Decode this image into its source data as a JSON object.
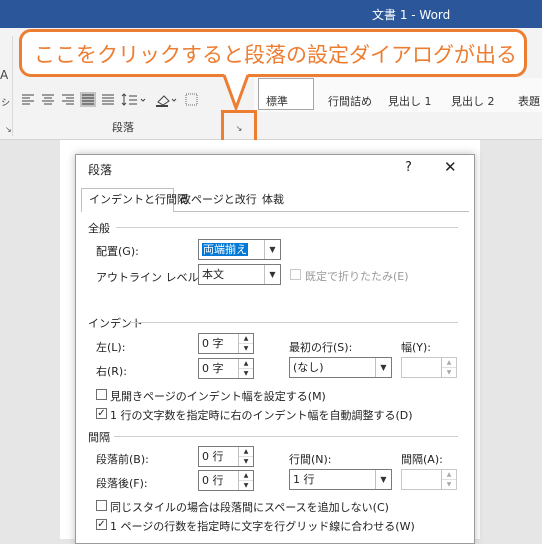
{
  "window": {
    "title": "文書 1 - Word"
  },
  "callout": {
    "text": "ここをクリックすると段落の設定ダイアログが出る"
  },
  "ribbon": {
    "left_glyphs": [
      "A",
      "ㇱ"
    ],
    "paragraph_group_label": "段落",
    "launcher_glyph": "↘",
    "styles": [
      {
        "label": "標準"
      },
      {
        "label": "行間詰め"
      },
      {
        "label": "見出し 1"
      },
      {
        "label": "見出し 2"
      },
      {
        "label": "表題"
      }
    ]
  },
  "dialog": {
    "title": "段落",
    "help": "?",
    "close": "✕",
    "tabs": [
      {
        "label": "インデントと行間隔",
        "active": true
      },
      {
        "label": "改ページと改行",
        "active": false
      },
      {
        "label": "体裁",
        "active": false
      }
    ],
    "general": {
      "section_label": "全般",
      "alignment_label": "配置(G):",
      "alignment_value": "両端揃え",
      "outline_label": "アウトライン レベル(O):",
      "outline_value": "本文",
      "collapsed_label": "既定で折りたたみ(E)"
    },
    "indent": {
      "section_label": "インデント",
      "left_label": "左(L):",
      "left_value": "0 字",
      "right_label": "右(R):",
      "right_value": "0 字",
      "first_line_label": "最初の行(S):",
      "first_line_value": "(なし)",
      "width_label": "幅(Y):",
      "width_value": "",
      "mirror_label": "見開きページのインデント幅を設定する(M)",
      "mirror_checked": false,
      "auto_adjust_label": "1 行の文字数を指定時に右のインデント幅を自動調整する(D)",
      "auto_adjust_checked": true
    },
    "spacing": {
      "section_label": "間隔",
      "before_label": "段落前(B):",
      "before_value": "0 行",
      "after_label": "段落後(F):",
      "after_value": "0 行",
      "line_spacing_label": "行間(N):",
      "line_spacing_value": "1 行",
      "at_label": "間隔(A):",
      "at_value": "",
      "no_space_label": "同じスタイルの場合は段落間にスペースを追加しない(C)",
      "no_space_checked": false,
      "grid_label": "1 ページの行数を指定時に文字を行グリッド線に合わせる(W)",
      "grid_checked": true
    }
  },
  "colors": {
    "accent": "#ed7d31",
    "word_blue": "#2b579a",
    "selection": "#0078d7"
  }
}
